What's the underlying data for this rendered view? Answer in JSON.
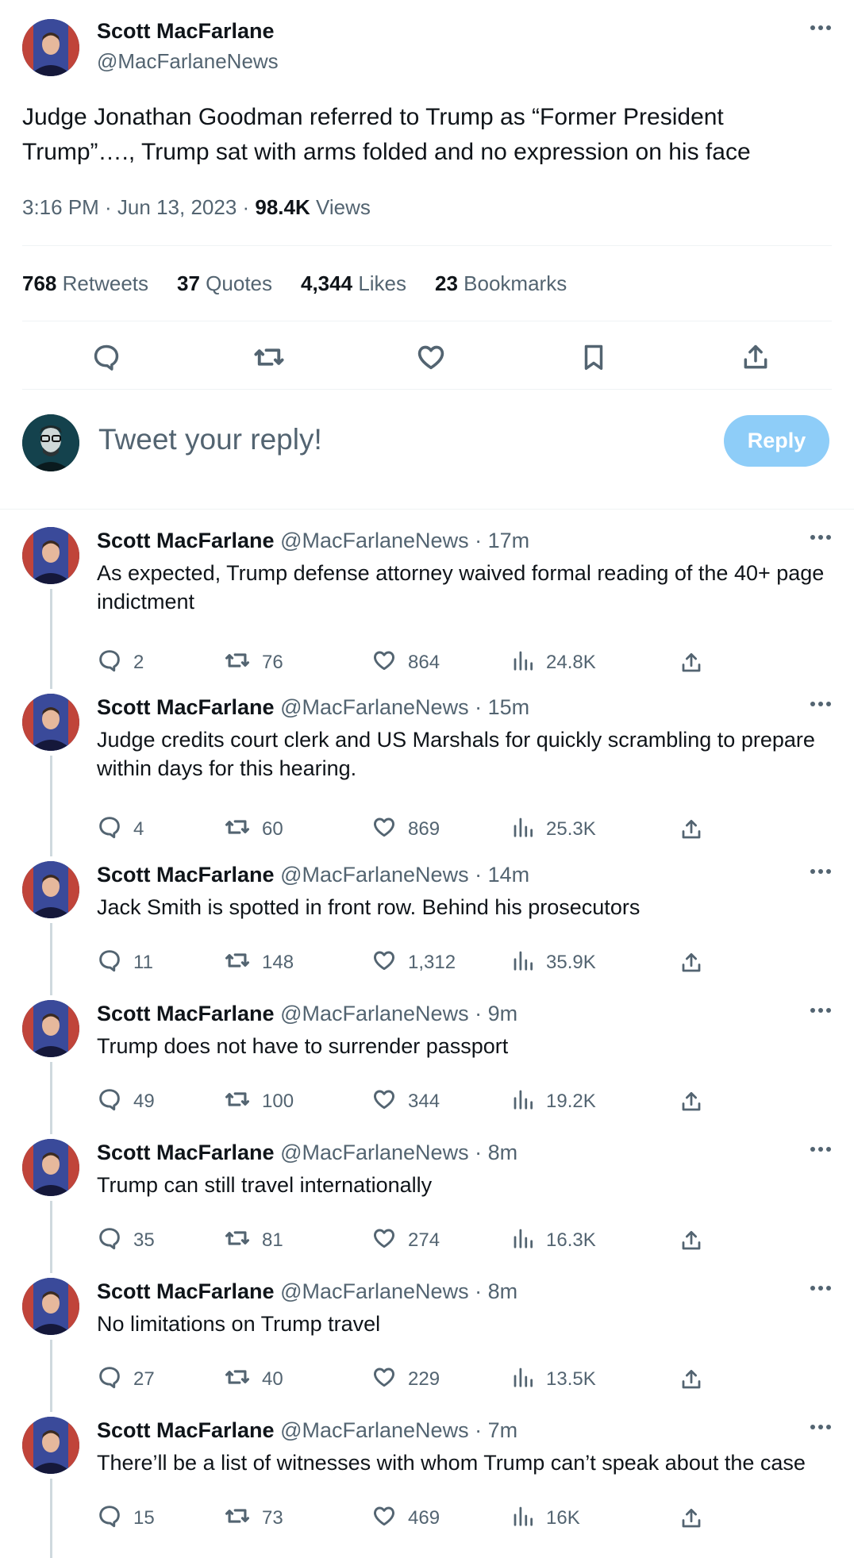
{
  "main": {
    "name": "Scott MacFarlane",
    "handle": "@MacFarlaneNews",
    "text": "Judge Jonathan Goodman referred to Trump as “Former President Trump”…., Trump sat with arms folded and no expression on his face",
    "time": "3:16 PM · Jun 13, 2023 · ",
    "views_count": "98.4K",
    "views_label": " Views",
    "stats": [
      {
        "count": "768",
        "label": "Retweets"
      },
      {
        "count": "37",
        "label": "Quotes"
      },
      {
        "count": "4,344",
        "label": "Likes"
      },
      {
        "count": "23",
        "label": "Bookmarks"
      }
    ]
  },
  "composer": {
    "placeholder": "Tweet your reply!",
    "button": "Reply"
  },
  "thread": [
    {
      "name": "Scott MacFarlane",
      "meta": "@MacFarlaneNews · 17m",
      "text": "As expected, Trump defense attorney waived formal reading of the 40+ page indictment",
      "replies": "2",
      "retweets": "76",
      "likes": "864",
      "views": "24.8K"
    },
    {
      "name": "Scott MacFarlane",
      "meta": "@MacFarlaneNews · 15m",
      "text": "Judge credits court clerk and US Marshals for quickly scrambling to prepare within days for this hearing.",
      "replies": "4",
      "retweets": "60",
      "likes": "869",
      "views": "25.3K"
    },
    {
      "name": "Scott MacFarlane",
      "meta": "@MacFarlaneNews · 14m",
      "text": "Jack Smith is spotted in front row.  Behind his prosecutors",
      "replies": "11",
      "retweets": "148",
      "likes": "1,312",
      "views": "35.9K"
    },
    {
      "name": "Scott MacFarlane",
      "meta": "@MacFarlaneNews · 9m",
      "text": "Trump does not have to surrender passport",
      "replies": "49",
      "retweets": "100",
      "likes": "344",
      "views": "19.2K"
    },
    {
      "name": "Scott MacFarlane",
      "meta": "@MacFarlaneNews · 8m",
      "text": "Trump can still travel internationally",
      "replies": "35",
      "retweets": "81",
      "likes": "274",
      "views": "16.3K"
    },
    {
      "name": "Scott MacFarlane",
      "meta": "@MacFarlaneNews · 8m",
      "text": "No limitations on Trump travel",
      "replies": "27",
      "retweets": "40",
      "likes": "229",
      "views": "13.5K"
    },
    {
      "name": "Scott MacFarlane",
      "meta": "@MacFarlaneNews · 7m",
      "text": "There’ll be a list of witnesses with whom Trump can’t speak about the case",
      "replies": "15",
      "retweets": "73",
      "likes": "469",
      "views": "16K"
    }
  ],
  "icons": [
    "more-icon",
    "reply-icon",
    "retweet-icon",
    "like-icon",
    "bookmark-icon",
    "share-icon",
    "views-icon"
  ],
  "colors": {
    "reply_button": "#8ecdf8",
    "muted": "#536471",
    "text": "#0f1419"
  }
}
